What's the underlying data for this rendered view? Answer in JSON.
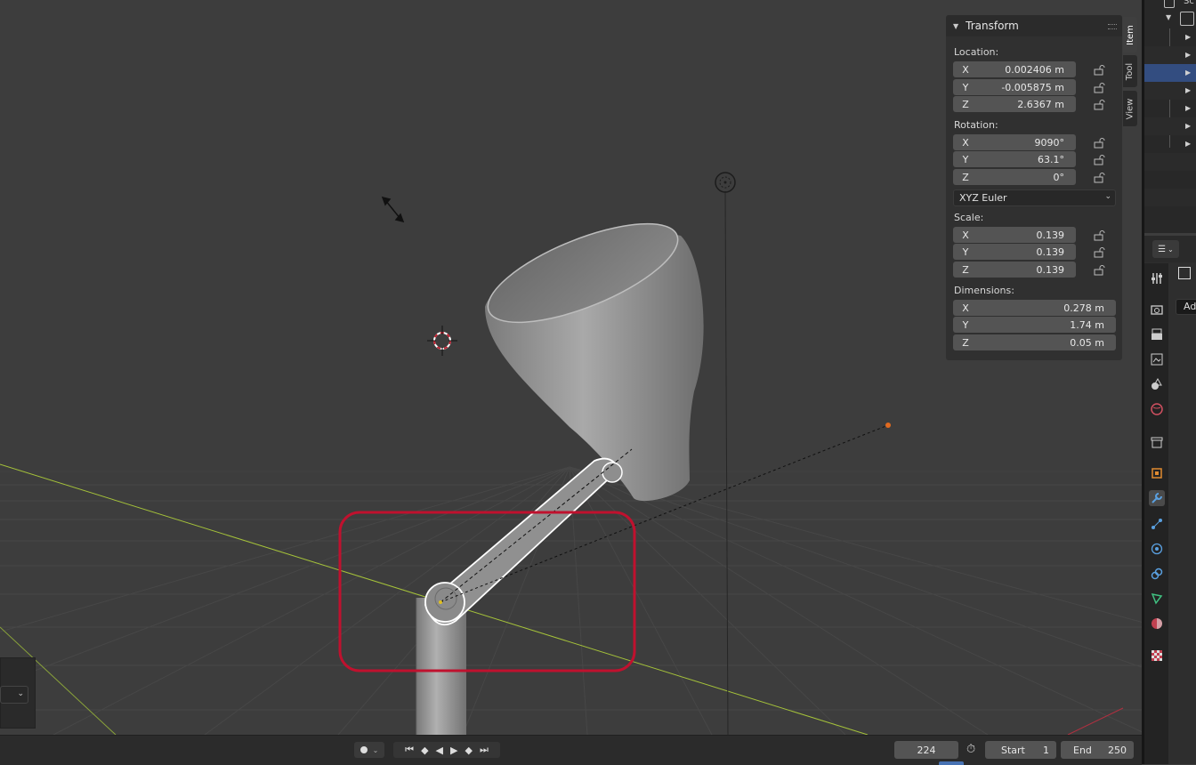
{
  "transform_panel": {
    "title": "Transform",
    "location": {
      "label": "Location:",
      "x": {
        "axis": "X",
        "value": "0.002406 m"
      },
      "y": {
        "axis": "Y",
        "value": "-0.005875 m"
      },
      "z": {
        "axis": "Z",
        "value": "2.6367 m"
      }
    },
    "rotation": {
      "label": "Rotation:",
      "x": {
        "axis": "X",
        "value": "9090°"
      },
      "y": {
        "axis": "Y",
        "value": "63.1°"
      },
      "z": {
        "axis": "Z",
        "value": "0°"
      }
    },
    "rotation_mode": "XYZ Euler",
    "scale": {
      "label": "Scale:",
      "x": {
        "axis": "X",
        "value": "0.139"
      },
      "y": {
        "axis": "Y",
        "value": "0.139"
      },
      "z": {
        "axis": "Z",
        "value": "0.139"
      }
    },
    "dimensions": {
      "label": "Dimensions:",
      "x": {
        "axis": "X",
        "value": "0.278 m"
      },
      "y": {
        "axis": "Y",
        "value": "1.74 m"
      },
      "z": {
        "axis": "Z",
        "value": "0.05 m"
      }
    }
  },
  "sidebar_tabs": [
    "Item",
    "Tool",
    "View"
  ],
  "outliner": {
    "header_text": "Sc"
  },
  "properties": {
    "tooltip": "Ad"
  },
  "timeline": {
    "current_frame": "224",
    "start_label": "Start",
    "start_value": "1",
    "end_label": "End",
    "end_value": "250"
  },
  "colors": {
    "viewport_bg": "#3d3d3d",
    "grid_line": "#4a4a4a",
    "x_axis": "#a5c23a",
    "highlight_box": "#c0112e",
    "selection_blue": "#334d80",
    "selected_outline": "#ffffff"
  }
}
